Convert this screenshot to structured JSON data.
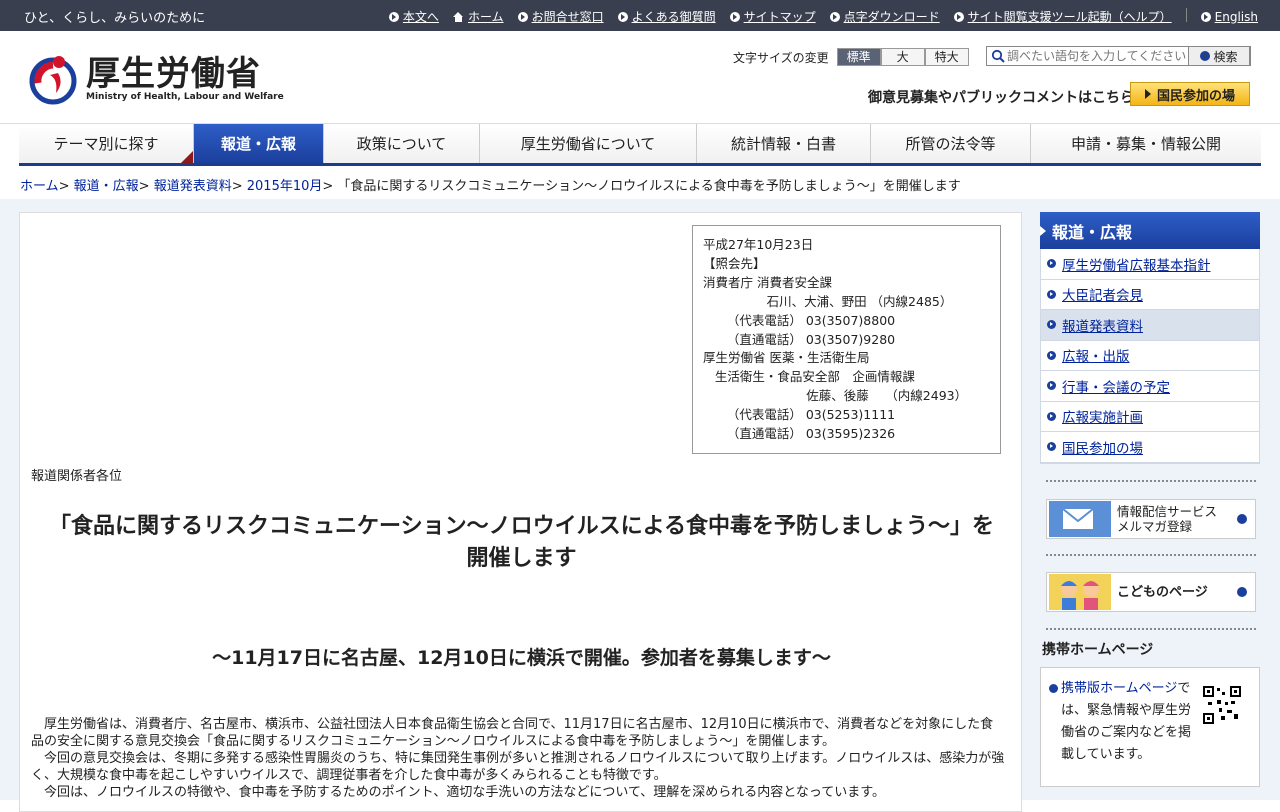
{
  "topbar": {
    "tagline": "ひと、くらし、みらいのために",
    "links": [
      "本文へ",
      "ホーム",
      "お問合せ窓口",
      "よくある御質問",
      "サイトマップ",
      "点字ダウンロード",
      "サイト閲覧支援ツール起動（ヘルプ）",
      "English"
    ]
  },
  "header": {
    "logo_jp": "厚生労働省",
    "logo_en": "Ministry of Health, Labour and Welfare",
    "font_size_label": "文字サイズの変更",
    "font_sizes": [
      "標準",
      "大",
      "特大"
    ],
    "search_placeholder": "調べたい語句を入力してください",
    "search_button": "検索",
    "opinion_link": "御意見募集やパブリックコメントはこちら",
    "kokumin_button": "国民参加の場"
  },
  "nav": {
    "items": [
      "テーマ別に探す",
      "報道・広報",
      "政策について",
      "厚生労働省について",
      "統計情報・白書",
      "所管の法令等",
      "申請・募集・情報公開"
    ],
    "active": "報道・広報"
  },
  "breadcrumb": {
    "links": [
      "ホーム",
      "報道・広報",
      "報道発表資料",
      "2015年10月"
    ],
    "current": "「食品に関するリスクコミュニケーション～ノロウイルスによる食中毒を予防しましょう～」を開催します"
  },
  "contact": {
    "text": "平成27年10月23日\n【照会先】\n消費者庁 消費者安全課\n                石川、大浦、野田 （内線2485）\n      （代表電話） 03(3507)8800\n      （直通電話） 03(3507)9280\n厚生労働省 医薬・生活衛生局\n   生活衛生・食品安全部　企画情報課\n                          佐藤、後藤　 （内線2493）\n      （代表電話） 03(5253)1111\n      （直通電話） 03(3595)2326"
  },
  "article": {
    "recipients": "報道関係者各位",
    "title": "「食品に関するリスクコミュニケーション～ノロウイルスによる食中毒を予防しましょう～」を開催します",
    "subtitle": "～11月17日に名古屋、12月10日に横浜で開催。参加者を募集します～",
    "paragraphs": [
      "厚生労働省は、消費者庁、名古屋市、横浜市、公益社団法人日本食品衛生協会と合同で、11月17日に名古屋市、12月10日に横浜市で、消費者などを対象にした食品の安全に関する意見交換会「食品に関するリスクコミュニケーション～ノロウイルスによる食中毒を予防しましょう～」を開催します。",
      "今回の意見交換会は、冬期に多発する感染性胃腸炎のうち、特に集団発生事例が多いと推測されるノロウイルスについて取り上げます。ノロウイルスは、感染力が強く、大規模な食中毒を起こしやすいウイルスで、調理従事者を介した食中毒が多くみられることも特徴です。",
      "今回は、ノロウイルスの特徴や、食中毒を予防するためのポイント、適切な手洗いの方法などについて、理解を深められる内容となっています。"
    ]
  },
  "sidebar": {
    "heading": "報道・広報",
    "items": [
      "厚生労働省広報基本指針",
      "大臣記者会見",
      "報道発表資料",
      "広報・出版",
      "行事・会議の予定",
      "広報実施計画",
      "国民参加の場"
    ],
    "current": "報道発表資料",
    "banner1_line1": "情報配信サービス",
    "banner1_line2": "メルマガ登録",
    "banner2": "こどものページ",
    "mobile_heading": "携帯ホームページ",
    "mobile_link": "携帯版ホームページ",
    "mobile_text": "では、緊急情報や厚生労働省のご案内などを掲載しています。"
  }
}
